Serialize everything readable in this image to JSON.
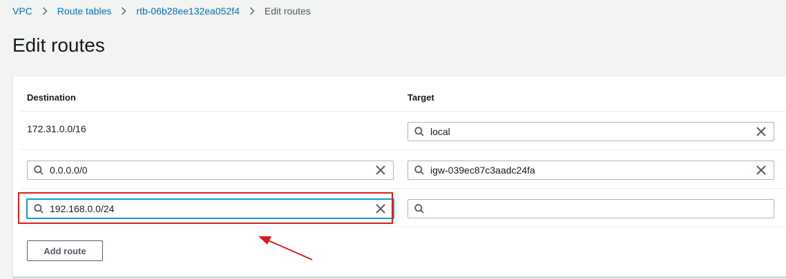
{
  "breadcrumb": {
    "items": [
      "VPC",
      "Route tables",
      "rtb-06b28ee132ea052f4"
    ],
    "current": "Edit routes"
  },
  "page": {
    "title": "Edit routes"
  },
  "routes_table": {
    "headers": {
      "destination": "Destination",
      "target": "Target"
    },
    "rows": [
      {
        "destination": "172.31.0.0/16",
        "target": "local"
      },
      {
        "destination": "0.0.0.0/0",
        "target": "igw-039ec87c3aadc24fa"
      },
      {
        "destination": "192.168.0.0/24",
        "target": ""
      }
    ]
  },
  "actions": {
    "add_route_label": "Add route"
  },
  "icons": {
    "search": "search-icon",
    "clear": "close-icon",
    "separator": "chevron-right-icon"
  },
  "colors": {
    "link": "#0073bb",
    "focus_border": "#00a1c9",
    "annotation": "#dd1b1b"
  }
}
